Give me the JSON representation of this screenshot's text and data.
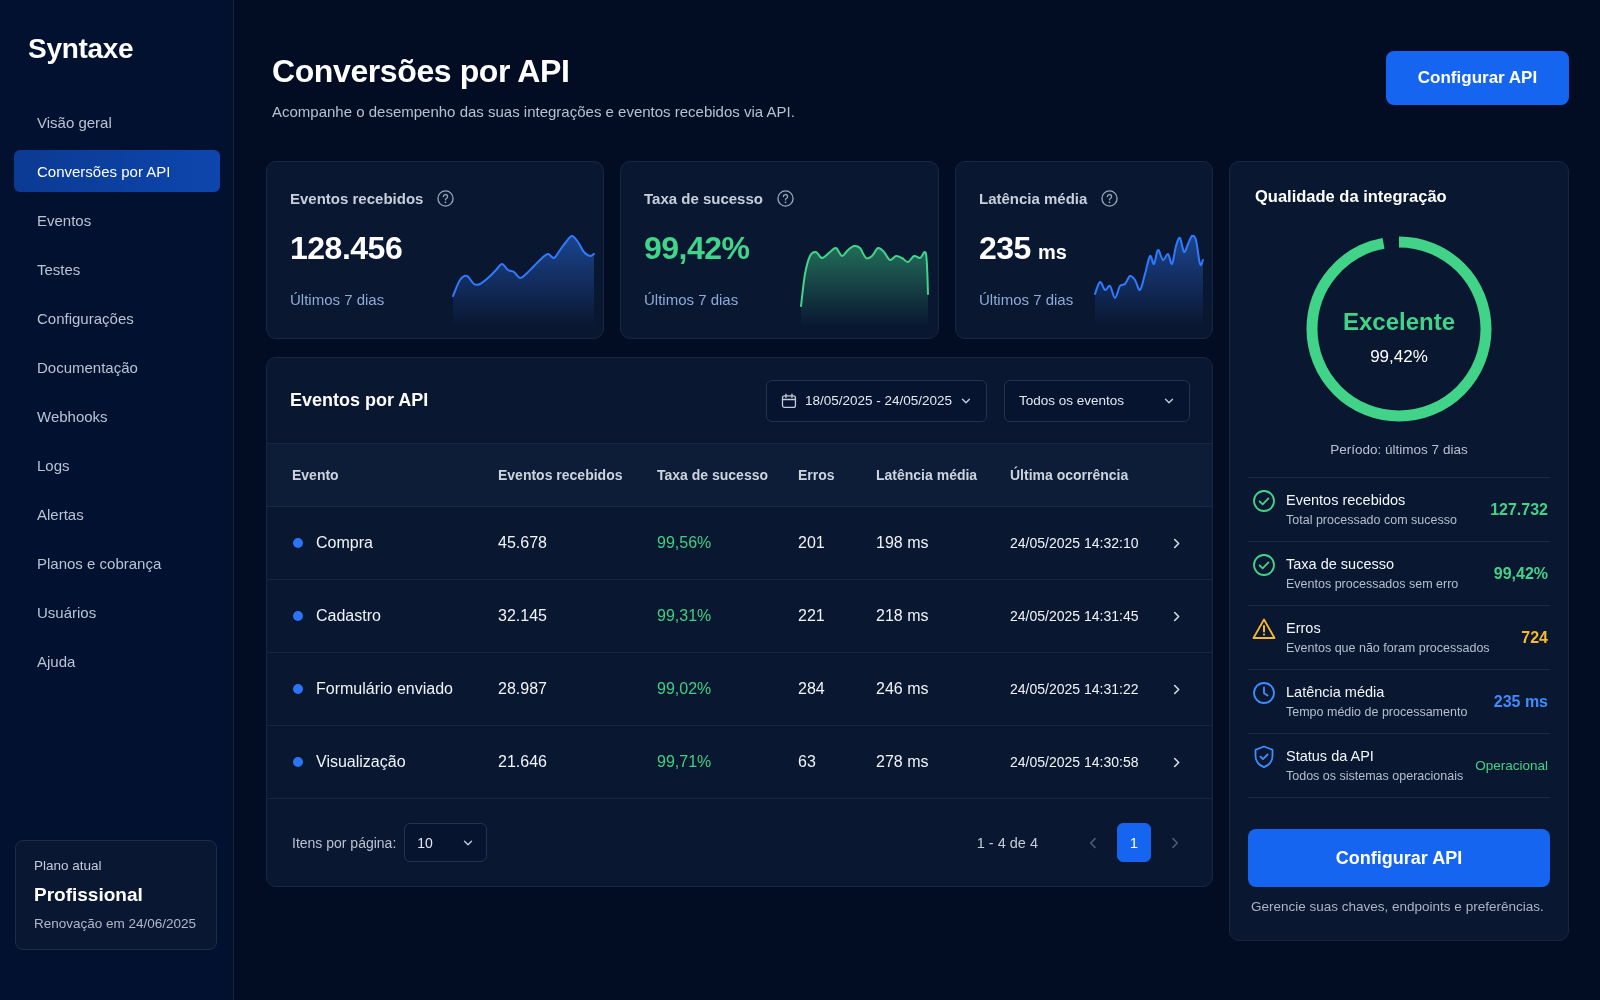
{
  "sidebar": {
    "brand": "Syntaxe",
    "items": [
      {
        "label": "Visão geral",
        "selected": false
      },
      {
        "label": "Conversões por API",
        "selected": true
      },
      {
        "label": "Eventos",
        "selected": false
      },
      {
        "label": "Testes",
        "selected": false
      },
      {
        "label": "Configurações",
        "selected": false
      },
      {
        "label": "Documentação",
        "selected": false
      },
      {
        "label": "Webhooks",
        "selected": false
      },
      {
        "label": "Logs",
        "selected": false
      },
      {
        "label": "Alertas",
        "selected": false
      },
      {
        "label": "Planos e cobrança",
        "selected": false
      },
      {
        "label": "Usuários",
        "selected": false
      },
      {
        "label": "Ajuda",
        "selected": false
      }
    ],
    "plan": {
      "caption": "Plano atual",
      "name": "Profissional",
      "renewal": "Renovação em 24/06/2025"
    }
  },
  "header": {
    "title": "Conversões por API",
    "subtitle": "Acompanhe o desempenho das suas integrações e eventos recebidos via API.",
    "button": "Configurar API"
  },
  "stats": [
    {
      "kind": "count",
      "label": "Eventos recebidos",
      "value": "128.456",
      "period": "Últimos 7 dias"
    },
    {
      "kind": "rate",
      "label": "Taxa de sucesso",
      "value": "99,42%",
      "period": "Últimos 7 dias"
    },
    {
      "kind": "latency",
      "label": "Latência média",
      "value": "235",
      "unit": "ms",
      "period": "Últimos 7 dias"
    }
  ],
  "table": {
    "title": "Eventos por API",
    "date_range": "18/05/2025 - 24/05/2025",
    "event_filter": "Todos os eventos",
    "columns": [
      "Evento",
      "Eventos recebidos",
      "Taxa de sucesso",
      "Erros",
      "Latência média",
      "Última ocorrência"
    ],
    "rows": [
      {
        "event": "Compra",
        "received": "45.678",
        "success_rate": "99,56%",
        "errors": "201",
        "latency": "198 ms",
        "last": "24/05/2025 14:32:10"
      },
      {
        "event": "Cadastro",
        "received": "32.145",
        "success_rate": "99,31%",
        "errors": "221",
        "latency": "218 ms",
        "last": "24/05/2025 14:31:45"
      },
      {
        "event": "Formulário enviado",
        "received": "28.987",
        "success_rate": "99,02%",
        "errors": "284",
        "latency": "246 ms",
        "last": "24/05/2025 14:31:22"
      },
      {
        "event": "Visualização",
        "received": "21.646",
        "success_rate": "99,71%",
        "errors": "63",
        "latency": "278 ms",
        "last": "24/05/2025 14:30:58"
      }
    ],
    "footer": {
      "per_page_label": "Itens por página:",
      "per_page": "10",
      "range": "1 - 4 de 4",
      "prev": {
        "disabled": true
      },
      "pages": [
        {
          "label": "1",
          "selected": true
        }
      ],
      "next": {
        "disabled": true
      }
    }
  },
  "quality": {
    "title": "Qualidade da integração",
    "rating": "Excelente",
    "value": "99,42%",
    "level": 0.97,
    "period": "Período: últimos 7 dias",
    "items": [
      {
        "kind": "success",
        "title": "Eventos recebidos",
        "subtitle": "Total processado com sucesso",
        "value": "127.732"
      },
      {
        "kind": "success",
        "title": "Taxa de sucesso",
        "subtitle": "Eventos processados sem erro",
        "value": "99,42%"
      },
      {
        "kind": "warning",
        "title": "Erros",
        "subtitle": "Eventos que não foram processados",
        "value": "724"
      },
      {
        "kind": "latency",
        "title": "Latência média",
        "subtitle": "Tempo médio de processamento",
        "value": "235 ms"
      },
      {
        "kind": "status",
        "title": "Status da API",
        "subtitle": "Todos os sistemas operacionais",
        "value": "Operacional"
      }
    ],
    "button": "Configurar API",
    "note": "Gerencie suas chaves, endpoints e preferências."
  }
}
